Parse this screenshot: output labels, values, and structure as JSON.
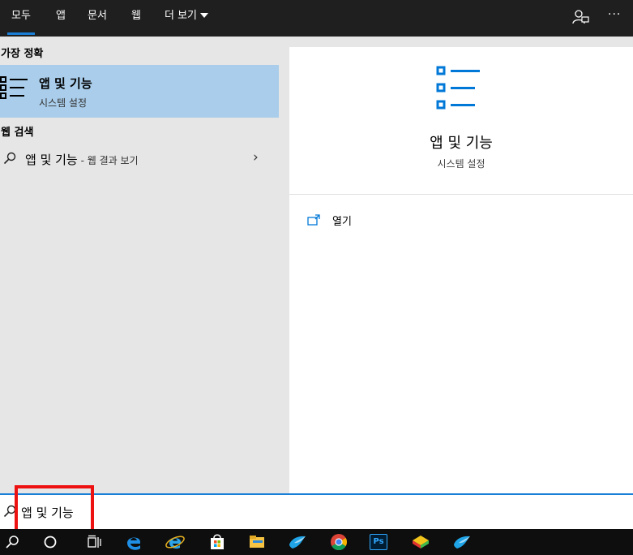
{
  "tabs": [
    {
      "label": "모두",
      "active": true
    },
    {
      "label": "앱"
    },
    {
      "label": "문서"
    },
    {
      "label": "웹"
    },
    {
      "label": "더 보기"
    }
  ],
  "top_actions": {
    "more_label": "···",
    "feedback_icon": "feedback-person-icon"
  },
  "best_match": {
    "heading": "가장 정확",
    "title": "앱 및 기능",
    "subtitle": "시스템 설정",
    "icon": "apps-list-icon"
  },
  "web_search": {
    "heading": "웹 검색",
    "query": "앱 및 기능",
    "suffix": " - 웹 결과 보기",
    "chevron": "›"
  },
  "preview": {
    "title": "앱 및 기능",
    "subtitle": "시스템 설정",
    "open_label": "열기"
  },
  "search": {
    "value": "앱 및 기능"
  },
  "taskbar": {
    "icons": [
      "search-icon",
      "cortana-icon",
      "task-view-icon",
      "edge-icon",
      "internet-explorer-icon",
      "store-icon",
      "file-explorer-icon",
      "app-bird-icon",
      "chrome-icon",
      "photoshop-icon",
      "bluestacks-icon",
      "app-bird-2-icon"
    ],
    "photoshop_label": "Ps"
  },
  "colors": {
    "accent": "#1a7fd6",
    "selected": "#a9cdea",
    "highlight": "#ee1111",
    "taskbar": "#0e0e0e"
  }
}
